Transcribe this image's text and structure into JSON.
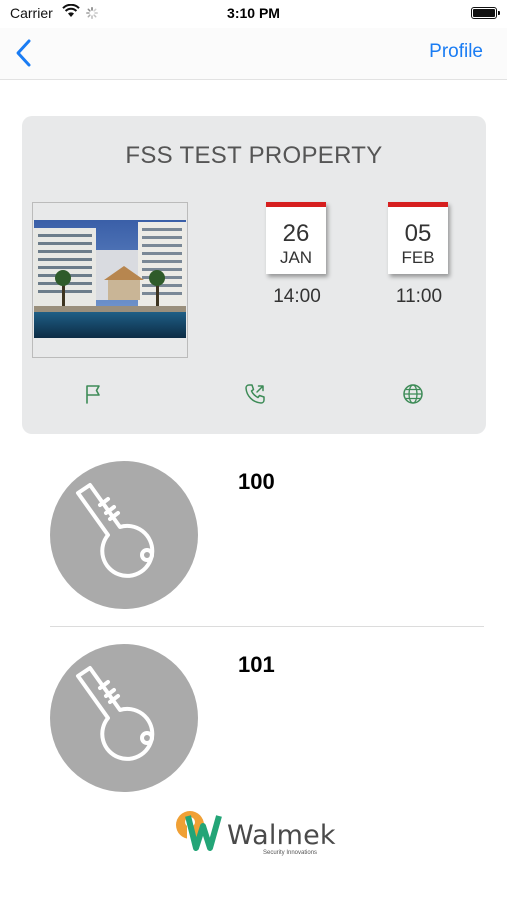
{
  "status_bar": {
    "carrier": "Carrier",
    "time": "3:10 PM",
    "battery_level": 1.0
  },
  "nav": {
    "back_icon": "chevron-left-icon",
    "profile_label": "Profile",
    "accent_color": "#1a7cf3"
  },
  "property": {
    "name": "FSS TEST PROPERTY",
    "photo": "hotel-photo",
    "check_in": {
      "day": "26",
      "month": "JAN",
      "time": "14:00"
    },
    "check_out": {
      "day": "05",
      "month": "FEB",
      "time": "11:00"
    },
    "actions": [
      "flag-icon",
      "phone-outgoing-icon",
      "globe-icon"
    ],
    "icon_color": "#3d8b57",
    "calendar_accent": "#d61f1f"
  },
  "rooms": [
    {
      "number": "100",
      "icon": "key-icon"
    },
    {
      "number": "101",
      "icon": "key-icon"
    }
  ],
  "footer": {
    "brand": "Walmek",
    "tagline": "Security Innovations"
  }
}
